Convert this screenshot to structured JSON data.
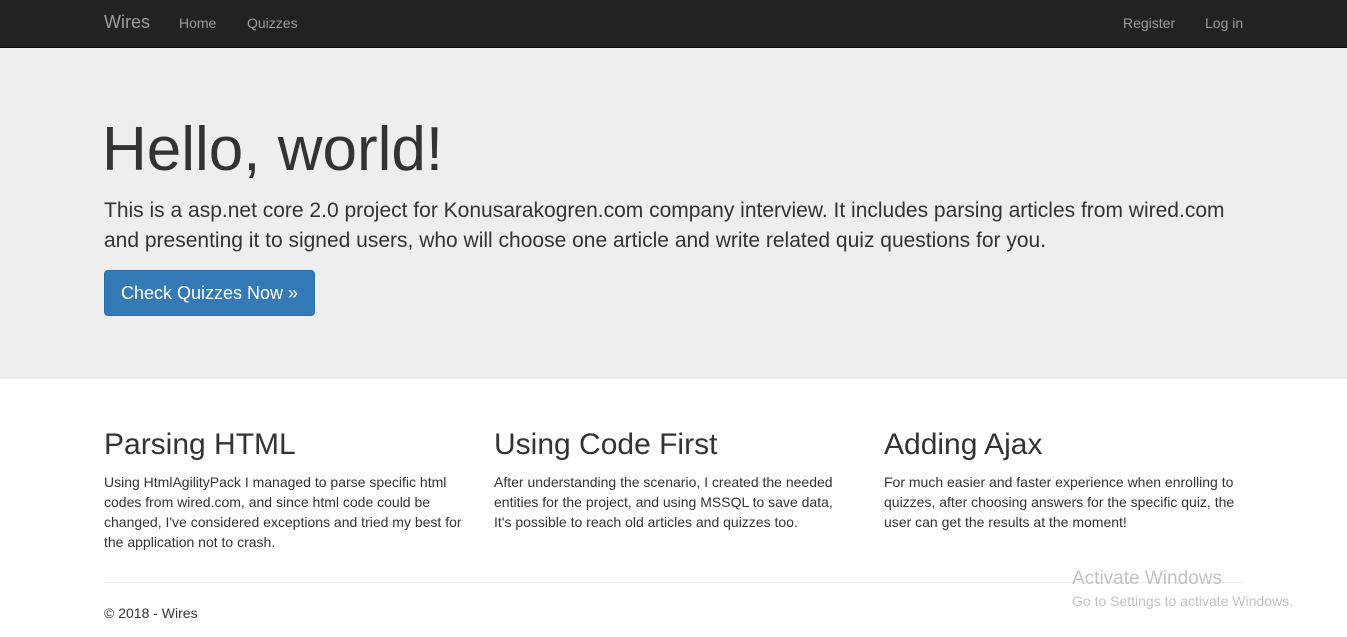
{
  "navbar": {
    "brand": "Wires",
    "left_links": [
      "Home",
      "Quizzes"
    ],
    "right_links": [
      "Register",
      "Log in"
    ]
  },
  "jumbotron": {
    "heading": "Hello, world!",
    "lead": "This is a asp.net core 2.0 project for Konusarakogren.com company interview. It includes parsing articles from wired.com and presenting it to signed users, who will choose one article and write related quiz questions for you.",
    "button_label": "Check Quizzes Now »"
  },
  "columns": [
    {
      "title": "Parsing HTML",
      "text": "Using HtmlAgilityPack I managed to parse specific html codes from wired.com, and since html code could be changed, I've considered exceptions and tried my best for the application not to crash."
    },
    {
      "title": "Using Code First",
      "text": "After understanding the scenario, I created the needed entities for the project, and using MSSQL to save data, It's possible to reach old articles and quizzes too."
    },
    {
      "title": "Adding Ajax",
      "text": "For much easier and faster experience when enrolling to quizzes, after choosing answers for the specific quiz, the user can get the results at the moment!"
    }
  ],
  "footer": {
    "copyright": "© 2018 - Wires"
  },
  "watermark": {
    "title": "Activate Windows",
    "subtitle": "Go to Settings to activate Windows."
  },
  "colors": {
    "navbar_bg": "#222222",
    "jumbotron_bg": "#eeeeee",
    "primary_button": "#337ab7",
    "text": "#333333"
  }
}
